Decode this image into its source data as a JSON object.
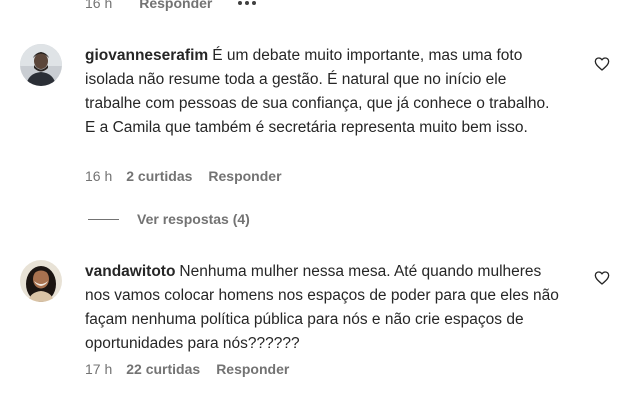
{
  "top_meta": {
    "time": "16 h",
    "reply_label": "Responder",
    "more_icon": "more-dots-icon"
  },
  "comments": [
    {
      "username": "giovanneserafim",
      "text": "É um debate muito importante, mas uma foto isolada não resume toda a gestão. É natural que no início ele trabalhe com pessoas de sua confiança, que já conhece o trabalho. E a Camila que também é secretária representa muito bem isso.",
      "time": "16 h",
      "likes": "2 curtidas",
      "reply_label": "Responder",
      "view_replies": "Ver respostas (4)",
      "like_icon": "heart-outline-icon"
    },
    {
      "username": "vandawitoto",
      "text": "Nenhuma mulher nessa mesa. Até quando mulheres nos vamos colocar homens nos espaços de poder para que eles não façam nenhuma política pública para nós e não crie espaços de oportunidades para nós??????",
      "time": "17 h",
      "likes": "22 curtidas",
      "reply_label": "Responder",
      "like_icon": "heart-outline-icon"
    }
  ],
  "colors": {
    "text": "#262626",
    "secondary": "#737373",
    "background": "#ffffff"
  }
}
